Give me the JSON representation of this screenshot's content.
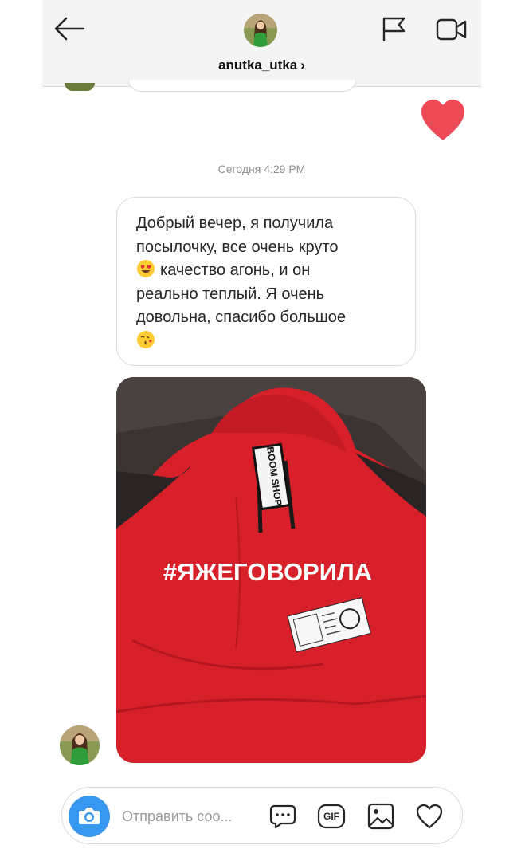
{
  "header": {
    "username": "anutka_utka",
    "chevron": "›",
    "back_icon": "arrow-left-icon",
    "flag_icon": "flag-icon",
    "video_icon": "video-camera-icon"
  },
  "chat": {
    "reaction_icon": "heart-icon",
    "reaction_color": "#ed4956",
    "timestamp": "Сегодня 4:29 PM",
    "message": {
      "line1": "Добрый вечер, я получила",
      "line2": "посылочку, все очень круто",
      "line3": "качество агонь, и он",
      "line4": "реально теплый. Я очень",
      "line5": "довольна, спасибо большое",
      "emoji1": "heart-eyes-emoji",
      "emoji2": "kissing-heart-emoji"
    },
    "photo": {
      "print_text": "#ЯЖЕГОВОРИЛА",
      "tag_text": "BOOM SHOP",
      "garment_color": "#d8202a"
    }
  },
  "composer": {
    "placeholder": "Отправить соо...",
    "camera_icon": "camera-icon",
    "sticker_icon": "chat-bubble-icon",
    "gif_label": "GIF",
    "gallery_icon": "image-icon",
    "like_icon": "heart-outline-icon",
    "accent": "#3897f0"
  }
}
